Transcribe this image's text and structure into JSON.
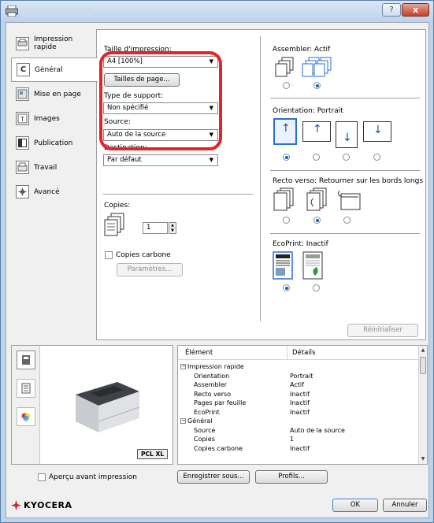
{
  "titlebar": {
    "help_label": "?",
    "close_label": "x"
  },
  "tabs": [
    {
      "label": "Impression\nrapide",
      "icon": "quick-print-icon"
    },
    {
      "label": "Général",
      "icon": "general-icon"
    },
    {
      "label": "Mise en page",
      "icon": "layout-icon"
    },
    {
      "label": "Images",
      "icon": "image-icon"
    },
    {
      "label": "Publication",
      "icon": "publishing-icon"
    },
    {
      "label": "Travail",
      "icon": "job-icon"
    },
    {
      "label": "Avancé",
      "icon": "advanced-icon"
    }
  ],
  "general": {
    "print_size_label": "Taille d'impression:",
    "print_size_value": "A4  [100%]",
    "page_sizes_button": "Tailles de page...",
    "media_type_label": "Type de support:",
    "media_type_value": "Non spécifié",
    "source_label": "Source:",
    "source_value": "Auto de la source",
    "destination_label": "Destination:",
    "destination_value": "Par défaut",
    "copies_label": "Copies:",
    "copies_value": "1",
    "carbon_copies_label": "Copies carbone",
    "parameters_button": "Paramètres...",
    "collate_label": "Assembler:  Actif",
    "orientation_label": "Orientation:  Portrait",
    "duplex_label": "Recto verso:  Retourner sur les bords longs",
    "ecoprint_label": "EcoPrint:  Inactif",
    "reset_button": "Réinitialiser"
  },
  "table": {
    "col_item": "Élément",
    "col_details": "Détails",
    "rows": [
      {
        "item": "Impression rapide",
        "details": "",
        "group": true
      },
      {
        "item": "Orientation",
        "details": "Portrait",
        "group": false
      },
      {
        "item": "Assembler",
        "details": "Actif",
        "group": false
      },
      {
        "item": "Recto verso",
        "details": "Inactif",
        "group": false
      },
      {
        "item": "Pages par feuille",
        "details": "Inactif",
        "group": false
      },
      {
        "item": "EcoPrint",
        "details": "Inactif",
        "group": false
      },
      {
        "item": "Général",
        "details": "",
        "group": true
      },
      {
        "item": "Source",
        "details": "Auto de la source",
        "group": false
      },
      {
        "item": "Copies",
        "details": "1",
        "group": false
      },
      {
        "item": "Copies carbone",
        "details": "Inactif",
        "group": false
      }
    ]
  },
  "preview": {
    "pdl_badge": "PCL XL"
  },
  "footer": {
    "preview_checkbox_label": "Aperçu avant impression",
    "save_as_button": "Enregistrer sous...",
    "profiles_button": "Profils...",
    "brand": "KYOCERA",
    "ok_button": "OK",
    "cancel_button": "Annuler"
  },
  "colors": {
    "accent": "#2b6fd1",
    "highlight": "#e2252b",
    "brand": "#d2202a"
  }
}
